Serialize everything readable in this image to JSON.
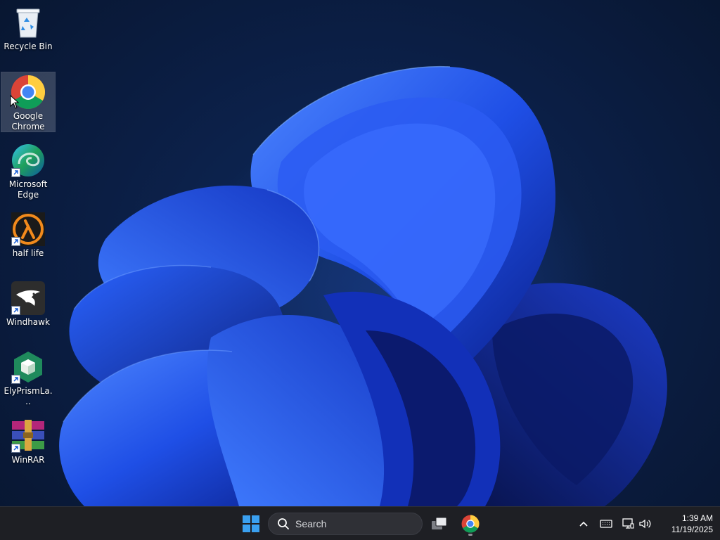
{
  "desktop": {
    "icons": [
      {
        "label": "Recycle Bin",
        "icon": "recycle-bin-icon",
        "shortcut": false
      },
      {
        "label": "Google Chrome",
        "icon": "chrome-icon",
        "shortcut": false,
        "selected": true
      },
      {
        "label": "Microsoft Edge",
        "icon": "edge-icon",
        "shortcut": true
      },
      {
        "label": "half life",
        "icon": "half-life-icon",
        "shortcut": true
      },
      {
        "label": "Windhawk",
        "icon": "windhawk-icon",
        "shortcut": true
      },
      {
        "label": "ElyPrismLa...",
        "icon": "elyprism-launcher-icon",
        "shortcut": true
      },
      {
        "label": "WinRAR",
        "icon": "winrar-icon",
        "shortcut": true
      }
    ]
  },
  "taskbar": {
    "start_icon": "windows-start-icon",
    "search": {
      "placeholder": "Search",
      "icon": "search-icon"
    },
    "apps": [
      {
        "name": "task-view",
        "icon": "task-view-icon"
      },
      {
        "name": "google-chrome",
        "icon": "chrome-icon",
        "running": true
      }
    ],
    "tray": {
      "icons": [
        "chevron-up-icon",
        "keyboard-icon",
        "network-icon",
        "volume-icon"
      ],
      "time": "1:39 AM",
      "date": "11/19/2025"
    }
  },
  "colors": {
    "taskbar_bg": "#1e1f24",
    "wallpaper_deep": "#0b1e44",
    "bloom_blue": "#2a5cff",
    "start_blue": "#3aa0f0"
  }
}
